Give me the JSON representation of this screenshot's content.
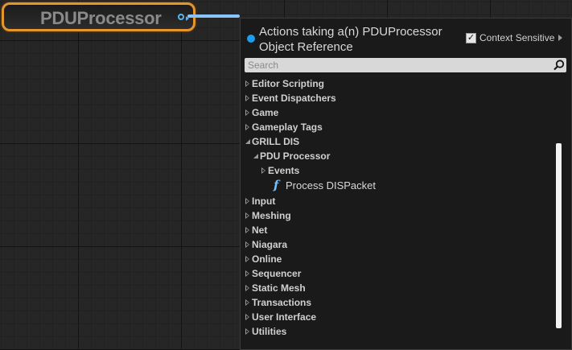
{
  "node": {
    "title": "PDUProcessor"
  },
  "menu": {
    "title": "Actions taking a(n) PDUProcessor Object Reference",
    "context_sensitive": {
      "label": "Context Sensitive",
      "checked": true
    },
    "search": {
      "placeholder": "Search",
      "value": ""
    },
    "items": [
      {
        "label": "Editor Scripting",
        "level": 0,
        "state": "collapsed"
      },
      {
        "label": "Event Dispatchers",
        "level": 0,
        "state": "collapsed"
      },
      {
        "label": "Game",
        "level": 0,
        "state": "collapsed"
      },
      {
        "label": "Gameplay Tags",
        "level": 0,
        "state": "collapsed"
      },
      {
        "label": "GRILL DIS",
        "level": 0,
        "state": "expanded"
      },
      {
        "label": "PDU Processor",
        "level": 1,
        "state": "expanded"
      },
      {
        "label": "Events",
        "level": 2,
        "state": "collapsed"
      },
      {
        "label": "Process DISPacket",
        "level": 3,
        "state": "function"
      },
      {
        "label": "Input",
        "level": 0,
        "state": "collapsed"
      },
      {
        "label": "Meshing",
        "level": 0,
        "state": "collapsed"
      },
      {
        "label": "Net",
        "level": 0,
        "state": "collapsed"
      },
      {
        "label": "Niagara",
        "level": 0,
        "state": "collapsed"
      },
      {
        "label": "Online",
        "level": 0,
        "state": "collapsed"
      },
      {
        "label": "Sequencer",
        "level": 0,
        "state": "collapsed"
      },
      {
        "label": "Static Mesh",
        "level": 0,
        "state": "collapsed"
      },
      {
        "label": "Transactions",
        "level": 0,
        "state": "collapsed"
      },
      {
        "label": "User Interface",
        "level": 0,
        "state": "collapsed"
      },
      {
        "label": "Utilities",
        "level": 0,
        "state": "collapsed"
      }
    ]
  },
  "icons": {
    "function": "function-icon",
    "search": "search-icon"
  },
  "colors": {
    "node_border": "#e2962c",
    "pin": "#56b6f0",
    "wire": "#8ac4ff",
    "accent_dot": "#1e9cf0"
  }
}
